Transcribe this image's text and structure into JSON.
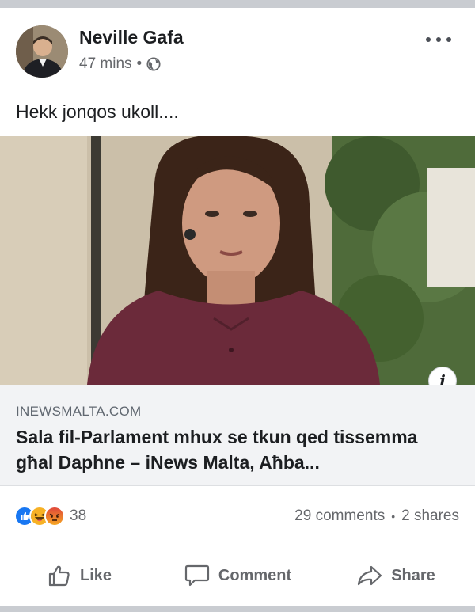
{
  "post": {
    "author": "Neville Gafa",
    "time": "47 mins",
    "separator": "•",
    "privacy_icon": "globe-icon",
    "text": "Hekk jonqos ukoll...."
  },
  "link": {
    "domain": "INEWSMALTA.COM",
    "title": "Sala fil-Parlament mhux se tkun qed tissemma għal Daphne – iNews Malta, Aħba...",
    "info_icon_label": "i"
  },
  "stats": {
    "reaction_icons": [
      "like-icon",
      "haha-icon",
      "angry-icon"
    ],
    "reaction_count": "38",
    "comments": "29 comments",
    "separator": "•",
    "shares": "2 shares"
  },
  "actions": {
    "like": "Like",
    "comment": "Comment",
    "share": "Share"
  },
  "colors": {
    "like_blue": "#1877f2",
    "haha_yellow": "#f7b125",
    "angry_orange": "#e9710f",
    "text_secondary": "#65676b",
    "separator_gray": "#c9ccd1"
  }
}
